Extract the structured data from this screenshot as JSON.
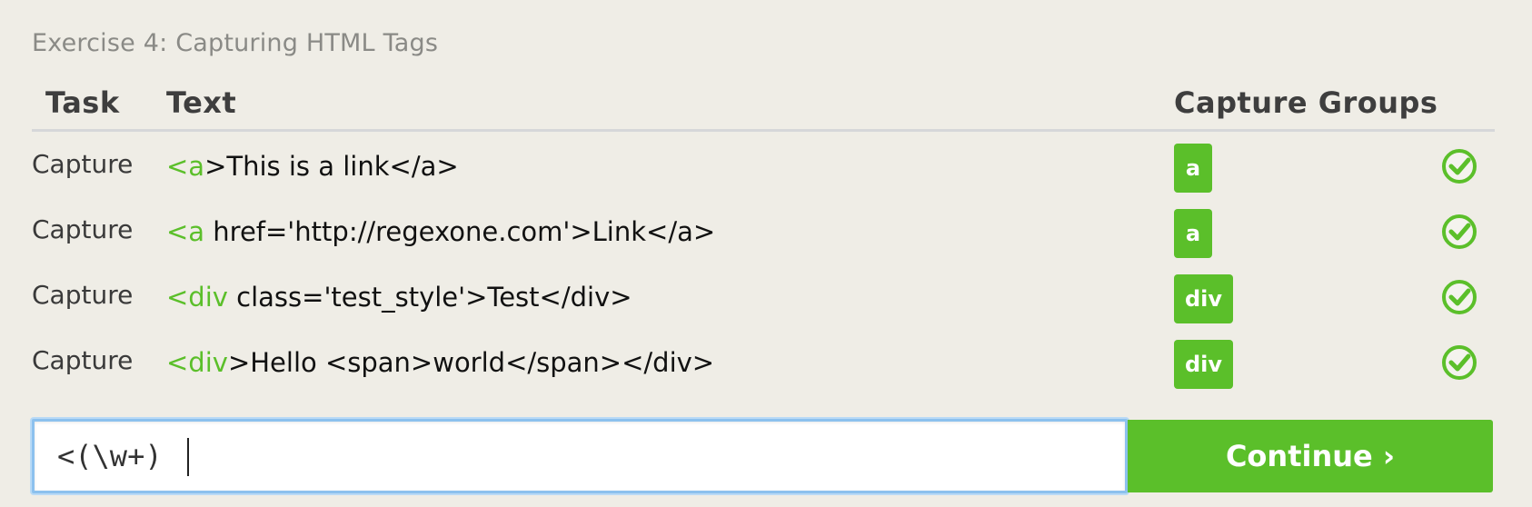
{
  "exercise": {
    "title": "Exercise 4: Capturing HTML Tags"
  },
  "table": {
    "headers": {
      "task": "Task",
      "text": "Text",
      "capture_groups": "Capture Groups"
    },
    "rows": [
      {
        "task": "Capture",
        "text_match": "<a",
        "text_rest": ">This is a link</a>",
        "groups": [
          "a"
        ],
        "status": "check-icon"
      },
      {
        "task": "Capture",
        "text_match": "<a",
        "text_rest": " href='http://regexone.com'>Link</a>",
        "groups": [
          "a"
        ],
        "status": "check-icon"
      },
      {
        "task": "Capture",
        "text_match": "<div",
        "text_rest": " class='test_style'>Test</div>",
        "groups": [
          "div"
        ],
        "status": "check-icon"
      },
      {
        "task": "Capture",
        "text_match": "<div",
        "text_rest": ">Hello <span>world</span></div>",
        "groups": [
          "div"
        ],
        "status": "check-icon"
      }
    ]
  },
  "input": {
    "value": "<(\\w+)"
  },
  "continue_button": {
    "label": "Continue ›"
  },
  "colors": {
    "accent": "#5bbf2a",
    "background": "#efede6",
    "input_focus": "#8cc1ee"
  }
}
